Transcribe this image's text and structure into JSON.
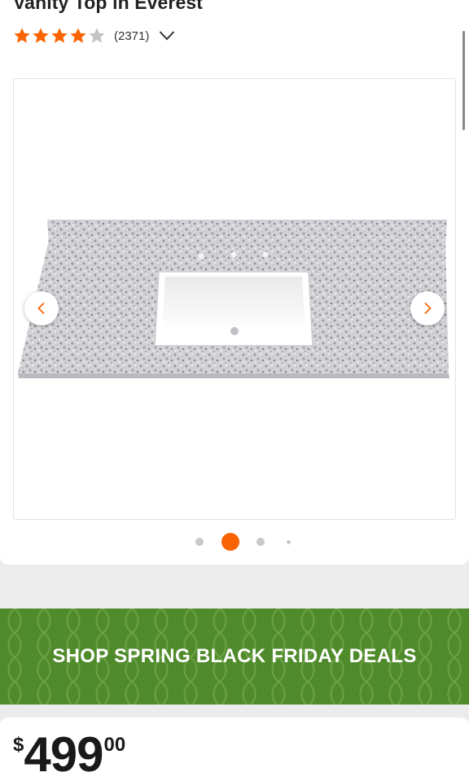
{
  "product": {
    "title": "Vanity Top in Everest",
    "rating": 4,
    "rating_max": 5,
    "review_count": "(2371)"
  },
  "gallery": {
    "slide_count": 4,
    "active_slide": 2,
    "image_icon": "vanity-top-image",
    "prev_icon": "chevron-left-icon",
    "next_icon": "chevron-right-icon"
  },
  "promo": {
    "label": "SHOP SPRING BLACK FRIDAY DEALS",
    "background_color": "#4f8a2b"
  },
  "price": {
    "currency": "$",
    "dollars": "499",
    "cents": "00"
  },
  "colors": {
    "accent": "#f96302",
    "star_empty": "#c4c4c4"
  }
}
